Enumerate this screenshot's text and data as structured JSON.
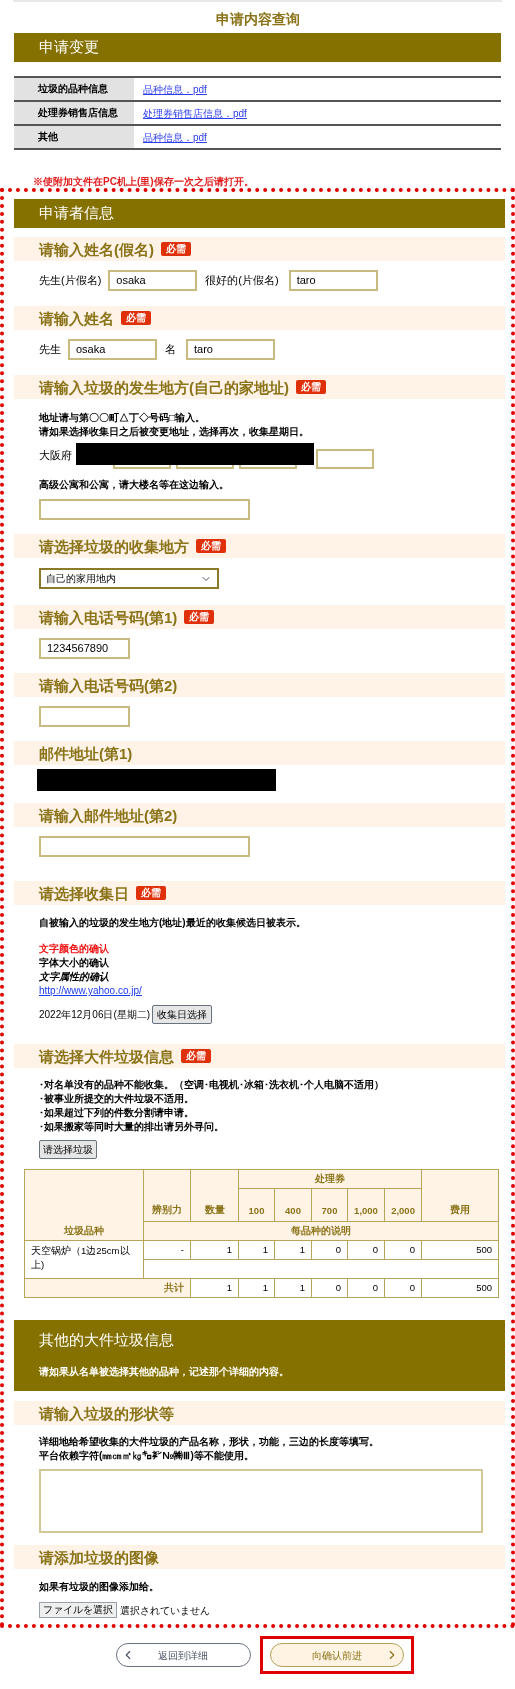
{
  "page_title": "申请内容查询",
  "change_section": {
    "title": "申请变更",
    "rows": [
      {
        "label": "垃圾的品种信息",
        "file": "品种信息．pdf"
      },
      {
        "label": "处理券销售店信息",
        "file": "处理券销售店信息．pdf"
      },
      {
        "label": "其他",
        "file": "品种信息．pdf"
      }
    ]
  },
  "notice": "※使附加文件在PC机上(里)保存一次之后请打开。",
  "applicant": {
    "title": "申请者信息",
    "sections": [
      {
        "kind": "name_pair",
        "heading": "请输入姓名(假名)",
        "badge": "必需",
        "fields": [
          {
            "label": "先生(片假名)",
            "value": "osaka"
          },
          {
            "label": "很好的(片假名)",
            "value": "taro"
          }
        ]
      },
      {
        "kind": "name_pair",
        "heading": "请输入姓名",
        "badge": "必需",
        "fields": [
          {
            "label": "先生",
            "value": "osaka"
          },
          {
            "label": "名",
            "value": "taro"
          }
        ]
      },
      {
        "kind": "address",
        "heading": "请输入垃圾的发生地方(自己的家地址)",
        "badge": "必需",
        "notes": [
          "地址请与第〇〇町△丁◇号码□输入。",
          "请如果选择收集日之后被变更地址，选择再次，收集星期日。"
        ],
        "prefecture": "大阪府",
        "building_note": "高级公寓和公寓，请大楼名等在这边输入。"
      },
      {
        "kind": "select",
        "heading": "请选择垃圾的收集地方",
        "badge": "必需",
        "value": "自己的家用地内"
      },
      {
        "kind": "short_input",
        "heading": "请输入电话号码(第1)",
        "badge": "必需",
        "value": "1234567890"
      },
      {
        "kind": "short_input",
        "heading": "请输入电话号码(第2)"
      },
      {
        "kind": "redacted",
        "heading": "邮件地址(第1)"
      },
      {
        "kind": "wide_input",
        "heading": "请输入邮件地址(第2)"
      },
      {
        "kind": "date",
        "heading": "请选择收集日",
        "badge": "必需",
        "note": "自被输入的垃圾的发生地方(地址)最近的收集候选日被表示。",
        "lines": [
          {
            "kind": "red",
            "text": "文字颜色的确认"
          },
          {
            "kind": "bold",
            "text": "字体大小的确认"
          },
          {
            "kind": "italic",
            "text": "文字属性的确认"
          },
          {
            "kind": "link",
            "text": "http://www.yahoo.co.jp/"
          }
        ],
        "date": "2022年12月06日(星期二)",
        "button": "收集日选择"
      },
      {
        "kind": "bulky",
        "heading": "请选择大件垃圾信息",
        "badge": "必需",
        "notes": [
          "･对名单没有的品种不能收集。（空调･电视机･冰箱･洗衣机･个人电脑不适用）",
          "･被事业所提交的大件垃圾不适用。",
          "･如果超过下列的件数分割请申请。",
          "･如果搬家等同时大量的排出请另外寻问。"
        ],
        "button": "请选择垃圾",
        "table": {
          "columns": {
            "item": "垃圾品种",
            "type": "辨别力",
            "qty": "数量",
            "tickets": "处理券",
            "denoms": [
              "100",
              "400",
              "700",
              "1,000",
              "2,000"
            ],
            "fee": "费用",
            "desc": "每品种的说明"
          },
          "rows": [
            {
              "item": "天空锅炉（1边25cm以上)",
              "type": "-",
              "qty": "1",
              "tickets": [
                "1",
                "1",
                "0",
                "0",
                "0"
              ],
              "fee": "500"
            }
          ],
          "total": {
            "label": "共计",
            "qty": "1",
            "tickets": [
              "1",
              "1",
              "0",
              "0",
              "0"
            ],
            "fee": "500"
          }
        }
      },
      {
        "kind": "banner",
        "title": "其他的大件垃圾信息",
        "note": "请如果从名单被选择其他的品种，记述那个详细的内容。"
      },
      {
        "kind": "textarea",
        "heading": "请输入垃圾的形状等",
        "notes": [
          "详细地给希望收集的大件垃圾的产品名称，形状，功能，三边的长度等填写。",
          "平台依赖字符(㎜㎝㎡㎏㌔㌢№㈱Ⅲ)等不能使用。"
        ]
      },
      {
        "kind": "file",
        "heading": "请添加垃圾的图像",
        "note": "如果有垃圾的图像添加给。",
        "button": "ファイルを選択",
        "status": "選択されていません"
      }
    ]
  },
  "footer": {
    "back": "返回到详细",
    "next": "向确认前进"
  }
}
